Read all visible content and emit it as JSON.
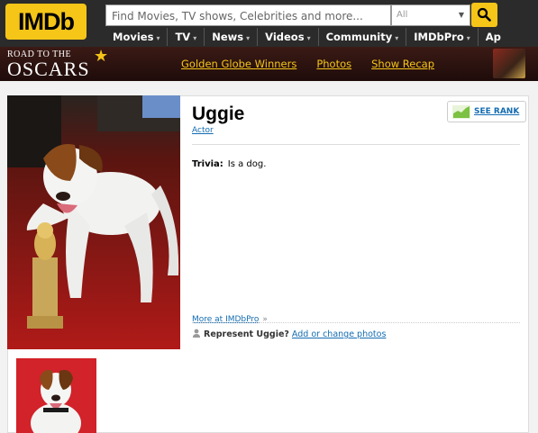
{
  "header": {
    "logo": "IMDb",
    "search": {
      "placeholder": "Find Movies, TV shows, Celebrities and more...",
      "category": "All"
    },
    "nav": [
      {
        "label": "Movies"
      },
      {
        "label": "TV"
      },
      {
        "label": "News"
      },
      {
        "label": "Videos"
      },
      {
        "label": "Community"
      },
      {
        "label": "IMDbPro"
      },
      {
        "label": "Ap"
      }
    ]
  },
  "promo": {
    "logo_top": "ROAD TO THE",
    "logo_main": "OSCARS",
    "links": [
      "Golden Globe Winners",
      "Photos",
      "Show Recap"
    ]
  },
  "profile": {
    "name": "Uggie",
    "job": "Actor",
    "rank_label": "SEE RANK",
    "trivia_label": "Trivia:",
    "trivia_text": "Is a dog.",
    "more_label": "More at IMDbPro",
    "more_sep": "»",
    "represent_label": "Represent Uggie?",
    "represent_link": "Add or change photos"
  },
  "colors": {
    "accent": "#f5c518",
    "link": "#136cb2",
    "nav_bg": "#2b2b2b"
  }
}
